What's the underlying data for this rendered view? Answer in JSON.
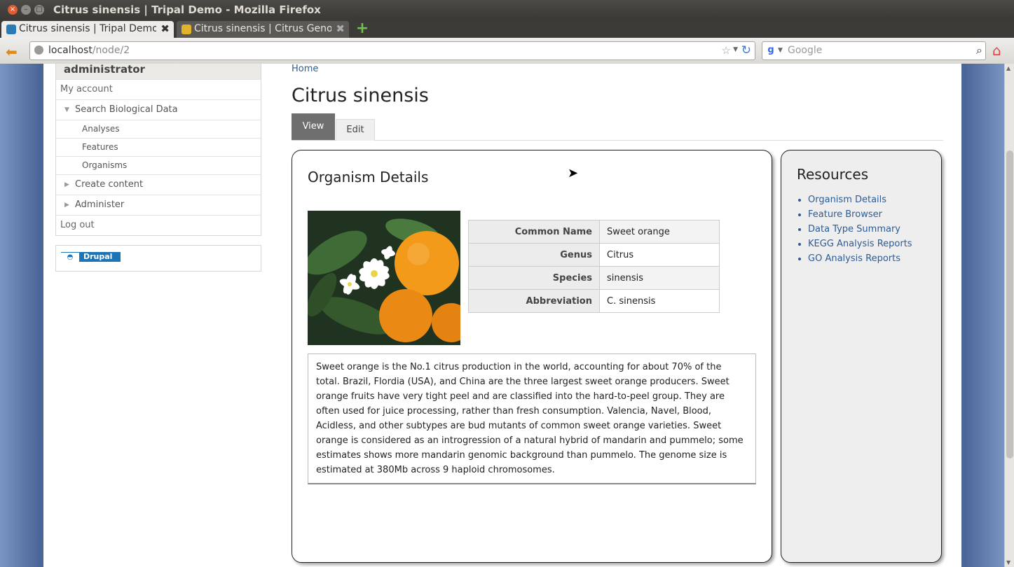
{
  "window": {
    "title": "Citrus sinensis | Tripal Demo - Mozilla Firefox"
  },
  "browser": {
    "tabs": [
      {
        "label": "Citrus sinensis | Tripal Demo"
      },
      {
        "label": "Citrus sinensis | Citrus Geno..."
      }
    ],
    "url_host": "localhost",
    "url_path": "/node/2",
    "search_placeholder": "Google"
  },
  "sidebar": {
    "user": "administrator",
    "items": [
      {
        "label": "My account"
      },
      {
        "label": "Search Biological Data"
      },
      {
        "label": "Analyses"
      },
      {
        "label": "Features"
      },
      {
        "label": "Organisms"
      },
      {
        "label": "Create content"
      },
      {
        "label": "Administer"
      },
      {
        "label": "Log out"
      }
    ],
    "badge": "Drupal"
  },
  "main": {
    "breadcrumb": "Home",
    "title": "Citrus sinensis",
    "tabs": [
      {
        "label": "View"
      },
      {
        "label": "Edit"
      }
    ]
  },
  "details": {
    "heading": "Organism Details",
    "rows": [
      {
        "key": "Common Name",
        "value": "Sweet orange"
      },
      {
        "key": "Genus",
        "value": "Citrus"
      },
      {
        "key": "Species",
        "value": "sinensis"
      },
      {
        "key": "Abbreviation",
        "value": "C. sinensis"
      }
    ],
    "description": "Sweet orange is the No.1 citrus production in the world, accounting for about 70% of the total. Brazil, Flordia (USA), and China are the three largest sweet orange producers. Sweet orange fruits have very tight peel and are classified into the hard-to-peel group. They are often used for juice processing, rather than fresh consumption. Valencia, Navel, Blood, Acidless, and other subtypes are bud mutants of common sweet orange varieties. Sweet orange is considered as an introgression of a natural hybrid of mandarin and pummelo; some estimates shows more mandarin genomic background than pummelo. The genome size is estimated at 380Mb across 9 haploid chromosomes."
  },
  "resources": {
    "heading": "Resources",
    "links": [
      {
        "label": "Organism Details"
      },
      {
        "label": "Feature Browser"
      },
      {
        "label": "Data Type Summary"
      },
      {
        "label": "KEGG Analysis Reports"
      },
      {
        "label": "GO Analysis Reports"
      }
    ]
  }
}
